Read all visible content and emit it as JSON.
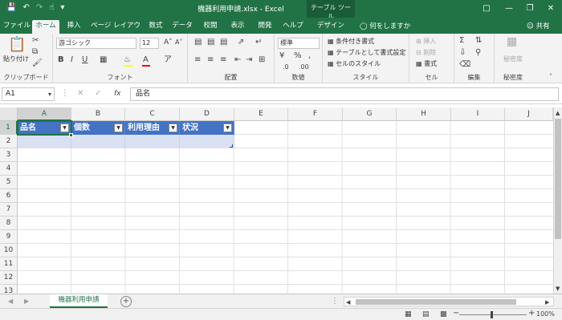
{
  "window": {
    "title": "機器利用申請.xlsx - Excel",
    "tabletools_label": "テーブル ツール",
    "minimize": "—",
    "restore": "❐",
    "close": "✕"
  },
  "ribbon_tabs": [
    {
      "label": "ファイル"
    },
    {
      "label": "ホーム"
    },
    {
      "label": "挿入"
    },
    {
      "label": "ページ レイアウト"
    },
    {
      "label": "数式"
    },
    {
      "label": "データ"
    },
    {
      "label": "校閲"
    },
    {
      "label": "表示"
    },
    {
      "label": "開発"
    },
    {
      "label": "ヘルプ"
    },
    {
      "label": "デザイン"
    }
  ],
  "tellme": "何をしますか",
  "share": "共有",
  "ribbon": {
    "clipboard": {
      "paste": "貼り付け",
      "label": "クリップボード"
    },
    "font": {
      "name": "游ゴシック",
      "size": "12",
      "label": "フォント"
    },
    "alignment": {
      "label": "配置"
    },
    "number": {
      "format": "標準",
      "label": "数値"
    },
    "styles": {
      "conditional": "条件付き書式",
      "as_table": "テーブルとして書式設定",
      "cell_styles": "セルのスタイル",
      "label": "スタイル"
    },
    "cells": {
      "insert": "挿入",
      "delete": "削除",
      "format": "書式",
      "label": "セル"
    },
    "editing": {
      "label": "編集"
    },
    "confidential": {
      "label": "秘密度",
      "button": "秘密度"
    }
  },
  "formula_bar": {
    "name_box": "A1",
    "fx": "fx",
    "content": "品名"
  },
  "columns": [
    "A",
    "B",
    "C",
    "D",
    "E",
    "F",
    "G",
    "H",
    "I",
    "J"
  ],
  "rows": [
    "1",
    "2",
    "3",
    "4",
    "5",
    "6",
    "7",
    "8",
    "9",
    "10",
    "11",
    "12",
    "13"
  ],
  "table_headers": [
    "品名",
    "個数",
    "利用理由",
    "状況"
  ],
  "sheet": {
    "name": "機器利用申請",
    "add": "+"
  },
  "status": {
    "zoom": "100%"
  }
}
